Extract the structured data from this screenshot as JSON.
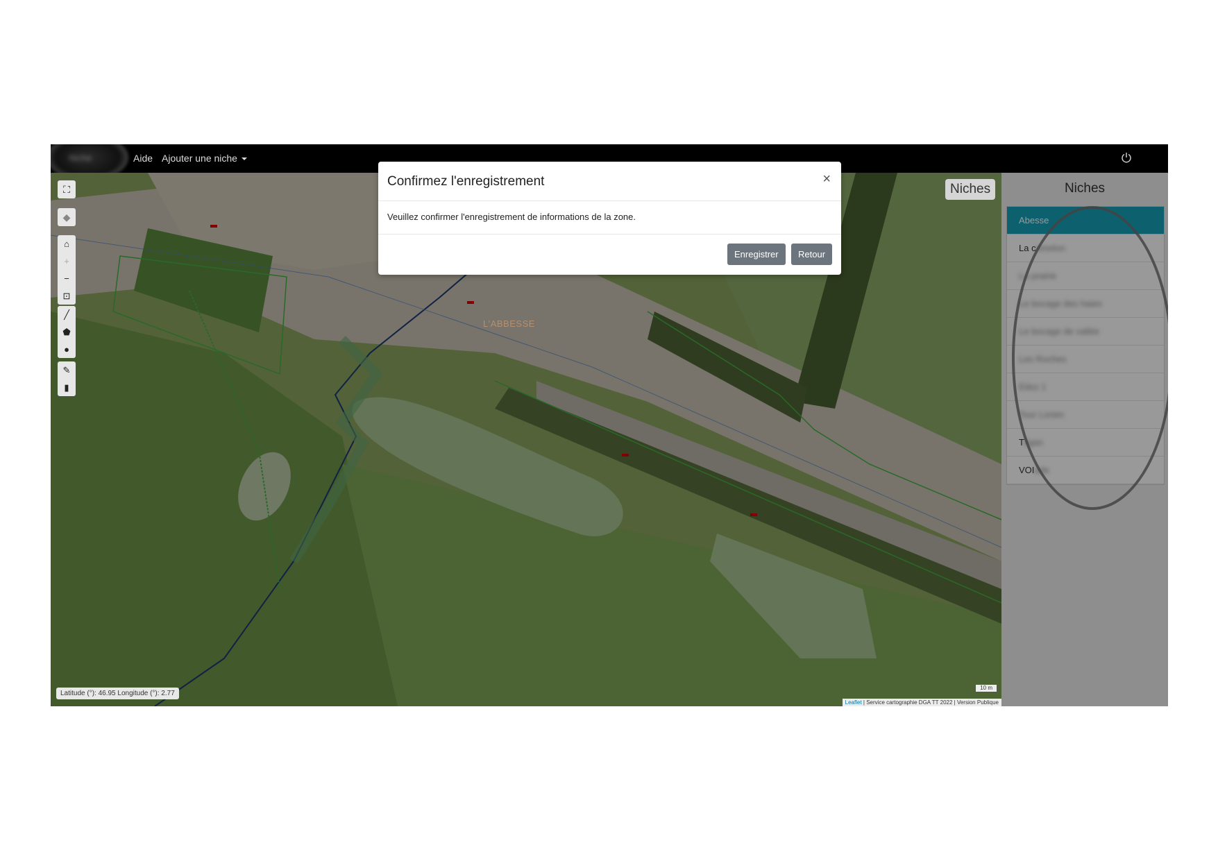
{
  "navbar": {
    "logo_text": "Niche",
    "aide": "Aide",
    "ajouter_niche": "Ajouter une niche",
    "power_icon": "power-icon"
  },
  "map": {
    "place_label": "L'ABBESSE",
    "niches_label": "Niches",
    "coords": "Latitude (°): 46.95 Longitude (°): 2.77",
    "scale": "10 m",
    "attribution_leaflet": "Leaflet",
    "attribution_rest": " | Service cartographie DGA TT 2022 | Version Publique",
    "toolbar_icons": [
      "fullscreen-icon",
      "layers-icon",
      "home-icon",
      "zoom-in-icon",
      "zoom-out-icon",
      "zoom-box-icon",
      "draw-line-icon",
      "draw-polygon-icon",
      "draw-marker-icon",
      "edit-icon",
      "delete-icon"
    ]
  },
  "sidebar": {
    "title": "Niches",
    "items": [
      {
        "label": "Abesse",
        "active": true
      },
      {
        "label": "La c",
        "blur": "omelon"
      },
      {
        "label": "",
        "blur": "La prairie"
      },
      {
        "label": "",
        "blur": "Le bocage des haies"
      },
      {
        "label": "",
        "blur": "Le bocage de vallée"
      },
      {
        "label": "",
        "blur": "Les Roches"
      },
      {
        "label": "",
        "blur": "Etiez 1"
      },
      {
        "label": "",
        "blur": "Tour Lorien"
      },
      {
        "label": "T",
        "blur": "ilgan"
      },
      {
        "label": "VOI",
        "blur": "ade"
      }
    ]
  },
  "modal": {
    "title": "Confirmez l'enregistrement",
    "close": "×",
    "body": "Veuillez confirmer l'enregistrement de informations de la zone.",
    "save": "Enregistrer",
    "back": "Retour"
  }
}
